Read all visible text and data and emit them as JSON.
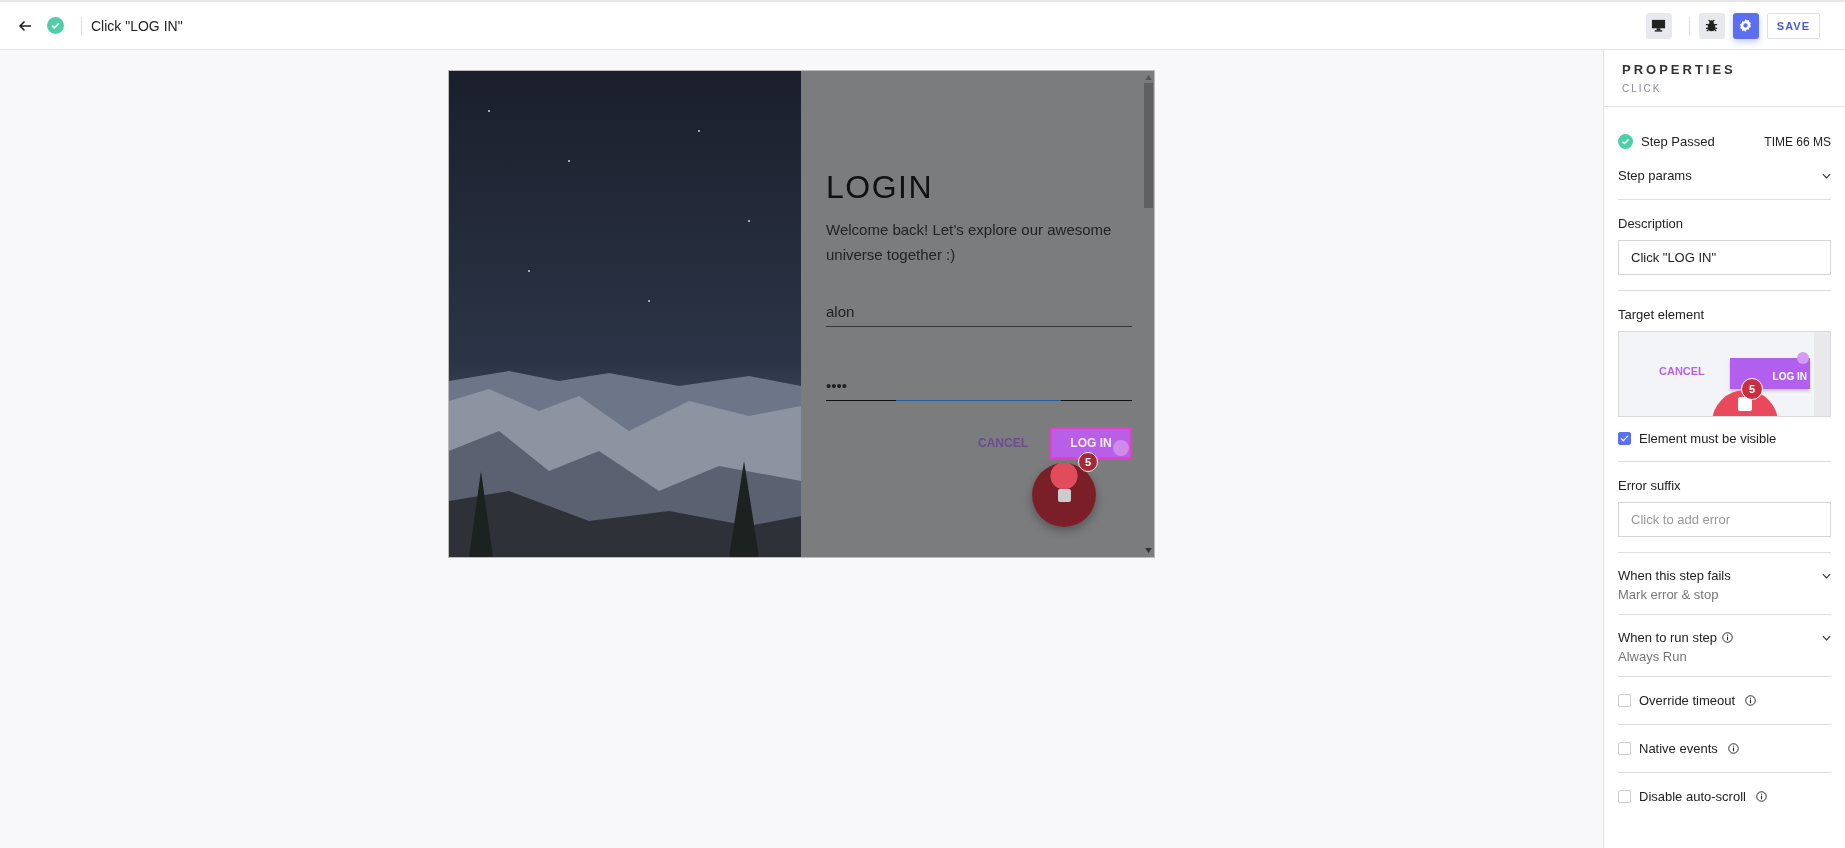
{
  "toolbar": {
    "passed": true,
    "title": "Click \"LOG IN\"",
    "tools": [
      {
        "kind": "monitor",
        "selected": false
      },
      {
        "kind": "bug",
        "selected": false
      },
      {
        "kind": "gear",
        "selected": true
      }
    ],
    "save": "SAVE"
  },
  "preview": {
    "heading": "LOGIN",
    "text": "Welcome back! Let’s explore our awesome universe together :)",
    "username": "alon",
    "password": "••••",
    "cancel": "CANCEL",
    "login": "LOG IN",
    "badge": "5"
  },
  "panel": {
    "title": "PROPERTIES",
    "subtitle": "CLICK",
    "passed": true,
    "status": "Step Passed",
    "time": "TIME 66 MS",
    "step_params": "Step params",
    "description": {
      "label": "Description",
      "value": "Click \"LOG IN\""
    },
    "target": {
      "label": "Target element",
      "cancel": "CANCEL",
      "login": "LOG IN",
      "badge": "5"
    },
    "must_be_visible": {
      "label": "Element must be visible",
      "checked": true
    },
    "error_suffix": {
      "label": "Error suffix",
      "placeholder": "Click to add error"
    },
    "dropdowns": [
      {
        "label": "When this step fails",
        "value": "Mark error & stop",
        "info": false
      },
      {
        "label": "When to run step",
        "value": "Always Run",
        "info": true
      }
    ],
    "options": [
      {
        "label": "Override timeout",
        "checked": false
      },
      {
        "label": "Native events",
        "checked": false
      },
      {
        "label": "Disable auto-scroll",
        "checked": false
      }
    ]
  }
}
